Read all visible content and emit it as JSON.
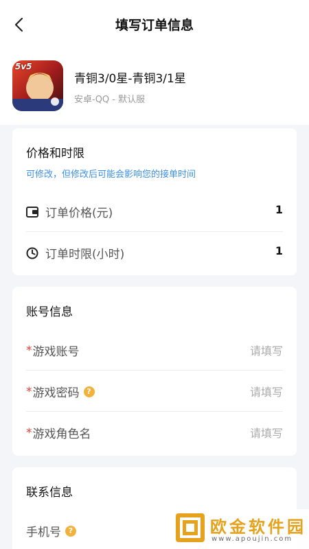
{
  "header": {
    "title": "填写订单信息"
  },
  "product": {
    "title": "青铜3/0星-青铜3/1星",
    "subtitle": "安卓-QQ - 默认服",
    "icon_badge": "5v5"
  },
  "pricing": {
    "title": "价格和时限",
    "note": "可修改，但修改后可能会影响您的接单时间",
    "rows": [
      {
        "label": "订单价格(元)",
        "value": "1",
        "icon": "wallet-icon"
      },
      {
        "label": "订单时限(小时)",
        "value": "1",
        "icon": "clock-icon"
      }
    ]
  },
  "account": {
    "title": "账号信息",
    "required_mark": "*",
    "rows": [
      {
        "label": "游戏账号",
        "placeholder": "请填写"
      },
      {
        "label": "游戏密码",
        "placeholder": "请填写",
        "help": "?"
      },
      {
        "label": "游戏角色名",
        "placeholder": "请填写"
      }
    ]
  },
  "contact": {
    "title": "联系信息",
    "rows": [
      {
        "label": "手机号",
        "help": "?"
      }
    ]
  },
  "watermark": {
    "text": "欧金软件园",
    "url": "www.apoujin.com"
  },
  "colors": {
    "accent_blue": "#3b8fe8",
    "required_red": "#e53935",
    "help_orange": "#f2b13b",
    "background": "#f4f5f8"
  }
}
